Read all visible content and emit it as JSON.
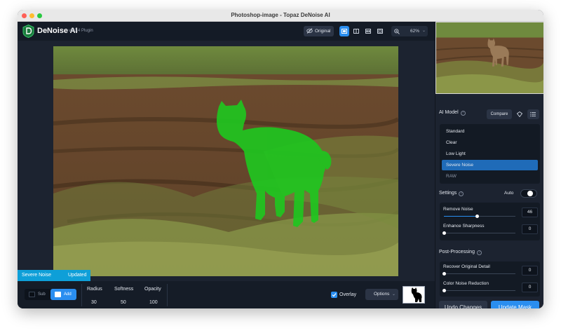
{
  "window": {
    "title": "Photoshop-image - Topaz DeNoise AI"
  },
  "app": {
    "name": "DeNoise AI",
    "version": "v3.3.4 Plugin"
  },
  "toolbar": {
    "original_label": "Original",
    "zoom_value": "62%",
    "accent_color": "#2a8ef0"
  },
  "status": {
    "model": "Severe Noise",
    "state": "Updated"
  },
  "mask_tools": {
    "sub_label": "Sub",
    "add_label": "Add",
    "radius_label": "Radius",
    "radius_value": "30",
    "softness_label": "Softness",
    "softness_value": "50",
    "opacity_label": "Opacity",
    "opacity_value": "100",
    "overlay_label": "Overlay",
    "overlay_checked": true,
    "options_label": "Options"
  },
  "sidebar": {
    "ai_model": {
      "title": "AI Model",
      "compare_label": "Compare",
      "items": [
        {
          "label": "Standard",
          "active": false
        },
        {
          "label": "Clear",
          "active": false
        },
        {
          "label": "Low Light",
          "active": false
        },
        {
          "label": "Severe Noise",
          "active": true
        },
        {
          "label": "RAW",
          "active": false
        }
      ]
    },
    "settings": {
      "title": "Settings",
      "auto_label": "Auto",
      "remove_noise_label": "Remove Noise",
      "remove_noise_value": "46",
      "enhance_sharpness_label": "Enhance Sharpness",
      "enhance_sharpness_value": "0"
    },
    "post_processing": {
      "title": "Post-Processing",
      "recover_detail_label": "Recover Original Detail",
      "recover_detail_value": "0",
      "color_noise_label": "Color Noise Reduction",
      "color_noise_value": "0"
    },
    "undo_label": "Undo Changes",
    "update_mask_label": "Update Mask"
  }
}
